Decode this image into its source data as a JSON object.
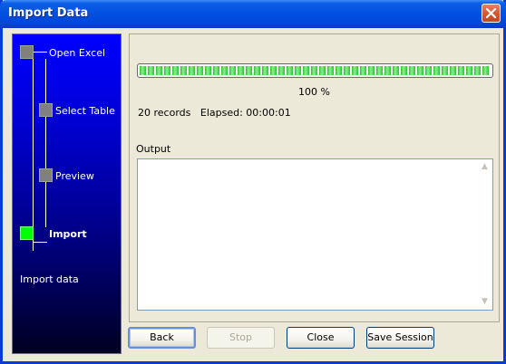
{
  "window": {
    "title": "Import Data",
    "close_icon": "close-icon"
  },
  "wizard": {
    "steps": [
      {
        "label": "Open Excel",
        "state": "done"
      },
      {
        "label": "Select Table",
        "state": "done"
      },
      {
        "label": "Preview",
        "state": "done"
      },
      {
        "label": "Import",
        "state": "active"
      }
    ],
    "description": "Import data"
  },
  "progress": {
    "value": 1.0,
    "percent_label": "100 %"
  },
  "stats": {
    "records": "20 records",
    "elapsed": "Elapsed: 00:00:01"
  },
  "output": {
    "label": "Output",
    "text": ""
  },
  "buttons": {
    "back": "Back",
    "stop": "Stop",
    "close": "Close",
    "save_session": "Save Session"
  },
  "colors": {
    "active_step": "#00ff00",
    "inactive_step": "#808080",
    "progress": "#2fc02f"
  }
}
